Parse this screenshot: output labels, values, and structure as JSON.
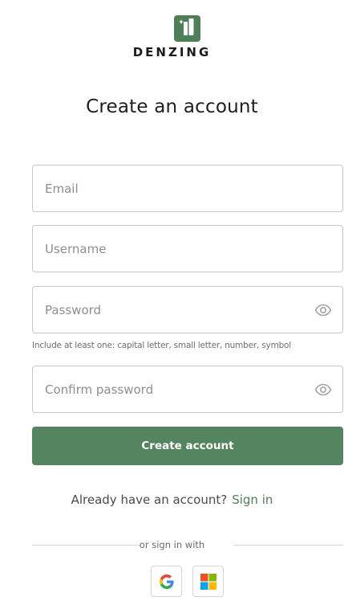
{
  "brand": {
    "name": "DENZING",
    "accent": "#548460"
  },
  "form": {
    "title": "Create an account",
    "email_placeholder": "Email",
    "username_placeholder": "Username",
    "password_placeholder": "Password",
    "password_hint": "Include at least one: capital letter, small letter, number, symbol",
    "confirm_placeholder": "Confirm password",
    "submit_label": "Create account"
  },
  "signin": {
    "prompt": "Already have an account?",
    "link_label": "Sign in"
  },
  "social": {
    "divider_text": "or sign in with",
    "providers": [
      {
        "name": "Google",
        "icon": "google-icon"
      },
      {
        "name": "Microsoft",
        "icon": "microsoft-icon"
      }
    ]
  }
}
